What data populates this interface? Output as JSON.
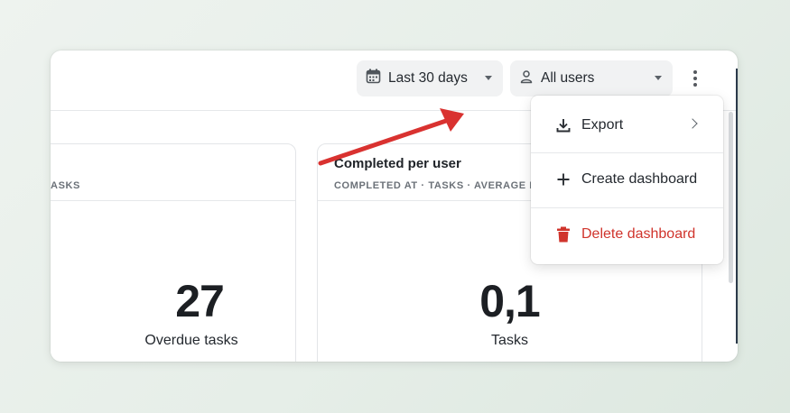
{
  "toolbar": {
    "date_filter": {
      "label": "Last 30 days",
      "icon": "calendar-icon"
    },
    "user_filter": {
      "label": "All users",
      "icon": "user-icon"
    },
    "more_icon": "more-vertical-icon"
  },
  "cards": [
    {
      "title": "",
      "subtitle": "ASKS",
      "value": "27",
      "caption": "Overdue tasks"
    },
    {
      "title": "Completed per user",
      "subtitle": "COMPLETED AT · TASKS · AVERAGE P",
      "value": "0,1",
      "caption": "Tasks"
    }
  ],
  "menu": {
    "items": [
      {
        "label": "Export",
        "icon": "download-icon",
        "has_submenu": true
      },
      {
        "label": "Create dashboard",
        "icon": "plus-icon"
      },
      {
        "label": "Delete dashboard",
        "icon": "trash-icon",
        "danger": true
      }
    ]
  },
  "colors": {
    "danger": "#d0342c",
    "annotation_arrow": "#d93230"
  }
}
